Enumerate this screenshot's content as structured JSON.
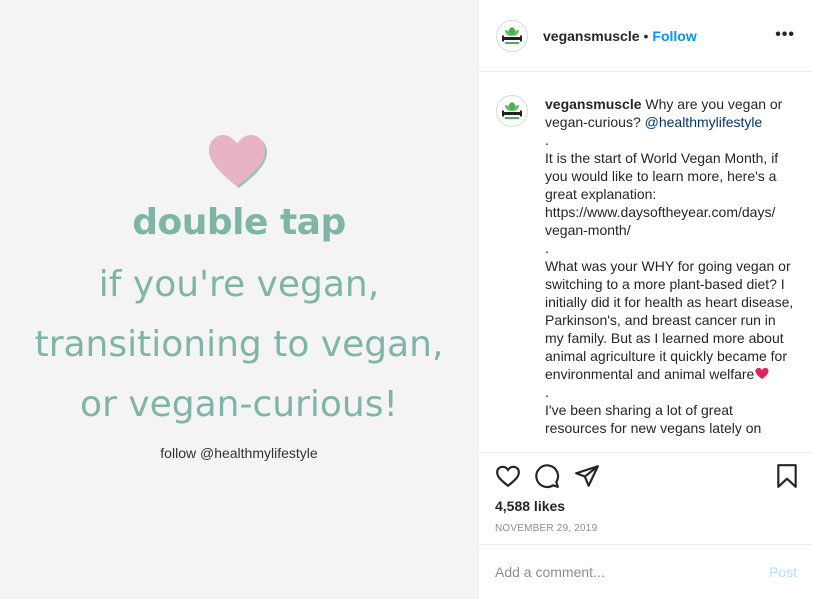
{
  "image": {
    "headline_bold": "double tap",
    "line1": "if you're vegan,",
    "line2": "transitioning to vegan,",
    "line3": "or vegan-curious!",
    "follow_note": "follow @healthmylifestyle",
    "text_color": "#7fb5a7",
    "heart_color": "#e8b4c4",
    "background": "#f4f4f4"
  },
  "header": {
    "username": "vegansmuscle",
    "separator": "•",
    "follow_label": "Follow",
    "more_label": "•••",
    "avatar_icon": "vegansmuscle-logo-icon"
  },
  "caption": {
    "username": "vegansmuscle",
    "text_start": "Why are you vegan or vegan-curious?",
    "mention": "@healthmylifestyle",
    "lines": [
      ".",
      "It is the start of World Vegan Month, if you would like to learn more, here's a great explanation:",
      "https://www.daysoftheyear.com/days/ vegan-month/",
      ".",
      "What was your WHY for going vegan or switching to a more plant-based diet? I initially did it for health as heart disease, Parkinson's, and breast cancer run in my family. But as I learned more about animal agriculture it quickly became for environmental and animal welfare",
      ".",
      "I've been sharing a lot of great resources for new vegans lately on"
    ],
    "emoji_icon": "red-heart-icon"
  },
  "actions": {
    "like_icon": "heart-icon",
    "comment_icon": "comment-icon",
    "share_icon": "paper-plane-icon",
    "save_icon": "bookmark-icon",
    "likes": "4,588 likes",
    "date": "NOVEMBER 29, 2019"
  },
  "comment_box": {
    "placeholder": "Add a comment...",
    "post_label": "Post"
  }
}
